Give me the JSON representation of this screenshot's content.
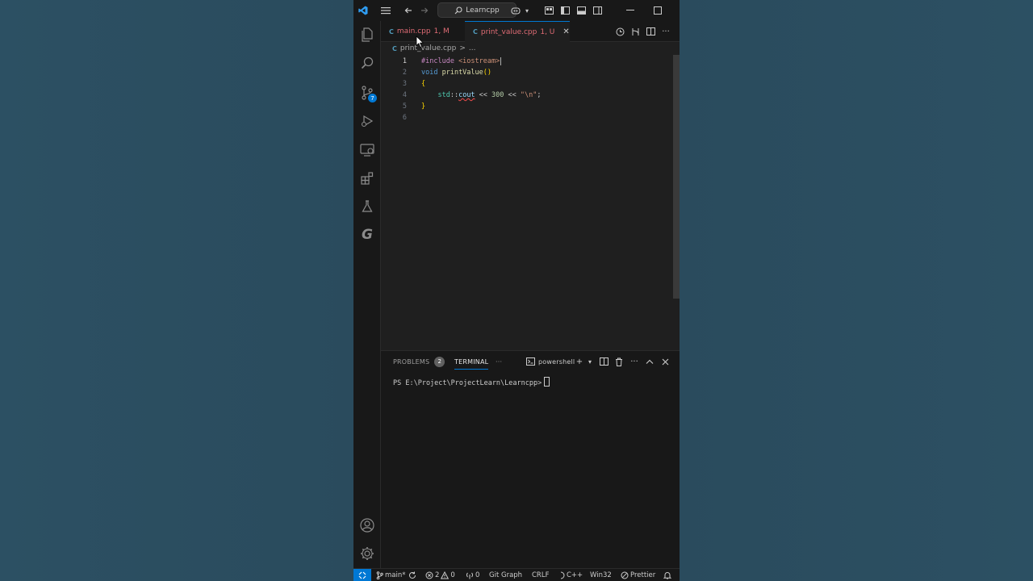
{
  "titlebar": {
    "search_text": "Learncpp"
  },
  "tabs": [
    {
      "name": "main.cpp",
      "status": "1, M",
      "color": "#e06c75"
    },
    {
      "name": "print_value.cpp",
      "status": "1, U",
      "color": "#e06c75"
    }
  ],
  "breadcrumb": {
    "file": "print_value.cpp",
    "sep": ">",
    "more": "..."
  },
  "activity_badge": "7",
  "editor": {
    "lines": [
      {
        "n": "1",
        "tokens": [
          {
            "t": "#include ",
            "c": "#c586c0"
          },
          {
            "t": "<iostream>",
            "c": "#ce9178"
          }
        ]
      },
      {
        "n": "2",
        "tokens": [
          {
            "t": "void ",
            "c": "#569cd6"
          },
          {
            "t": "printValue",
            "c": "#dcdcaa"
          },
          {
            "t": "()",
            "c": "#ffd700"
          }
        ]
      },
      {
        "n": "3",
        "tokens": [
          {
            "t": "{",
            "c": "#ffd700"
          }
        ]
      },
      {
        "n": "4",
        "tokens": [
          {
            "t": "    std",
            "c": "#4ec9b0"
          },
          {
            "t": "::",
            "c": "#cccccc"
          },
          {
            "t": "cout",
            "c": "#9cdcfe"
          },
          {
            "t": " << ",
            "c": "#cccccc"
          },
          {
            "t": "300",
            "c": "#b5cea8"
          },
          {
            "t": " << ",
            "c": "#cccccc"
          },
          {
            "t": "\"\\n\"",
            "c": "#ce9178"
          },
          {
            "t": ";",
            "c": "#cccccc"
          }
        ]
      },
      {
        "n": "5",
        "tokens": [
          {
            "t": "}",
            "c": "#ffd700"
          }
        ]
      },
      {
        "n": "6",
        "tokens": []
      }
    ]
  },
  "panel": {
    "problems_label": "PROBLEMS",
    "problems_count": "2",
    "terminal_label": "TERMINAL",
    "more": "···",
    "shell": "powershell",
    "prompt": "PS E:\\Project\\ProjectLearn\\Learncpp>"
  },
  "statusbar": {
    "branch": "main*",
    "errors": "2",
    "warnings": "0",
    "ports": "0",
    "git_graph": "Git Graph",
    "eol": "CRLF",
    "language": "C++",
    "platform": "Win32",
    "prettier": "Prettier"
  }
}
